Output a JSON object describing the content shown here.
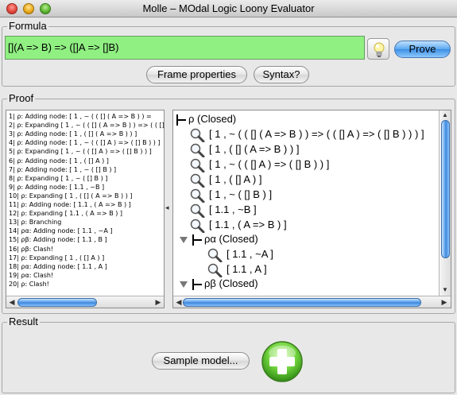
{
  "window": {
    "title": "Molle – MOdal Logic Loony Evaluator"
  },
  "formula": {
    "group_label": "Formula",
    "value": "[](A => B) => ([]A => []B)",
    "prove_label": "Prove",
    "frame_properties_label": "Frame properties",
    "syntax_label": "Syntax?"
  },
  "proof": {
    "group_label": "Proof",
    "log": [
      "1| ρ: Adding node: [ 1 , ~ ( ( [] ( A => B ) ) =",
      "2| ρ: Expanding [ 1 , ~ ( ( [] ( A => B ) ) => ( ( [] A",
      "3| ρ: Adding node: [ 1 , ( [] ( A => B ) ) ]",
      "4| ρ: Adding node: [ 1 , ~ ( ( [] A ) => ( [] B ) ) ]",
      "5| ρ: Expanding [ 1 , ~ ( ( [] A ) => ( [] B ) ) ]",
      "6| ρ: Adding node: [ 1 , ( [] A ) ]",
      "7| ρ: Adding node: [ 1 , ~ ( [] B ) ]",
      "8| ρ: Expanding [ 1 , ~ ( [] B ) ]",
      "9| ρ: Adding node: [ 1.1 , ~B ]",
      "10| ρ: Expanding [ 1 , ( [] ( A => B ) ) ]",
      "11| ρ: Adding node: [ 1.1 , ( A => B ) ]",
      "12| ρ: Expanding [ 1.1 , ( A => B ) ]",
      "13| ρ: Branching",
      "14| ρα: Adding node: [ 1.1 , ~A ]",
      "15| ρβ: Adding node: [ 1.1 , B ]",
      "16| ρβ: Clash!",
      "17| ρ: Expanding [ 1 , ( [] A ) ]",
      "18| ρα: Adding node: [ 1.1 , A ]",
      "19| ρα: Clash!",
      "20| ρ: Clash!"
    ],
    "tree": {
      "root_label": "ρ (Closed)",
      "root_nodes": [
        "[ 1 , ~ ( ( [] ( A => B ) ) => ( ( [] A ) => ( [] B ) ) ) ]",
        "[ 1 , ( [] ( A => B ) ) ]",
        "[ 1 , ~ ( ( [] A ) => ( [] B ) ) ]",
        "[ 1 , ( [] A ) ]",
        "[ 1 , ~ ( [] B ) ]",
        "[ 1.1 , ~B ]",
        "[ 1.1 , ( A => B ) ]"
      ],
      "alpha_label": "ρα (Closed)",
      "alpha_nodes": [
        "[ 1.1 , ~A ]",
        "[ 1.1 , A ]"
      ],
      "beta_label": "ρβ (Closed)"
    }
  },
  "result": {
    "group_label": "Result",
    "sample_model_label": "Sample model..."
  },
  "icons": {
    "bulb": "lightbulb-icon",
    "node": "magnifier-icon",
    "add": "plus-icon"
  },
  "colors": {
    "formula_bg": "#90f082",
    "prove_button": "#4f98e8",
    "add_button": "#6fd23c"
  }
}
